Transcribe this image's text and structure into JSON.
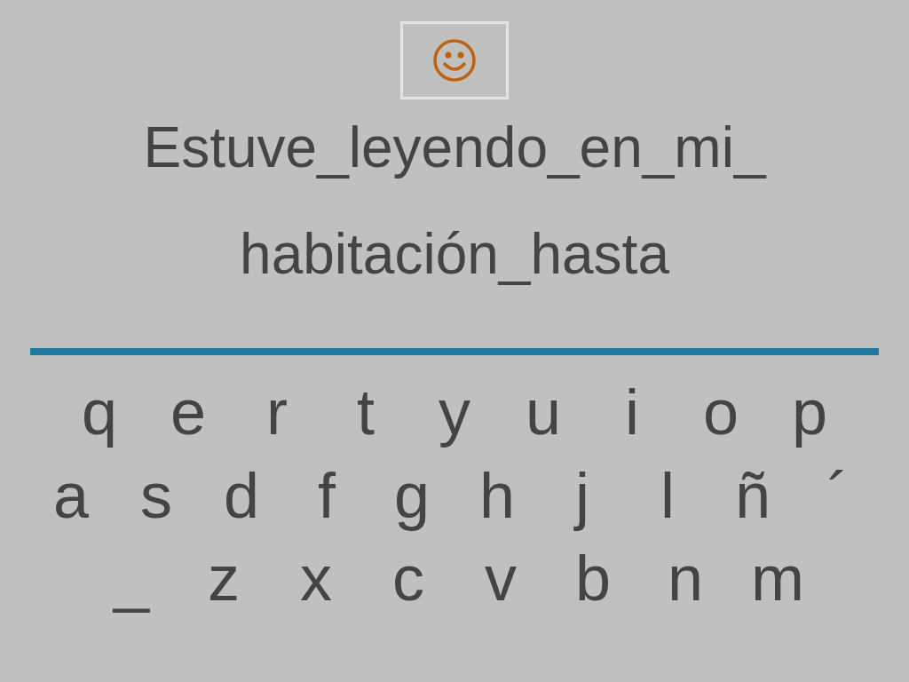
{
  "sentence_lines": [
    "Estuve_leyendo_en_mi_",
    "habitación_hasta"
  ],
  "keyboard_rows": [
    [
      "q",
      "e",
      "r",
      "t",
      "y",
      "u",
      "i",
      "o",
      "p"
    ],
    [
      "a",
      "s",
      "d",
      "f",
      "g",
      "h",
      "j",
      "l",
      "ñ",
      "´"
    ],
    [
      "_",
      "z",
      "x",
      "c",
      "v",
      "b",
      "n",
      "m"
    ]
  ]
}
